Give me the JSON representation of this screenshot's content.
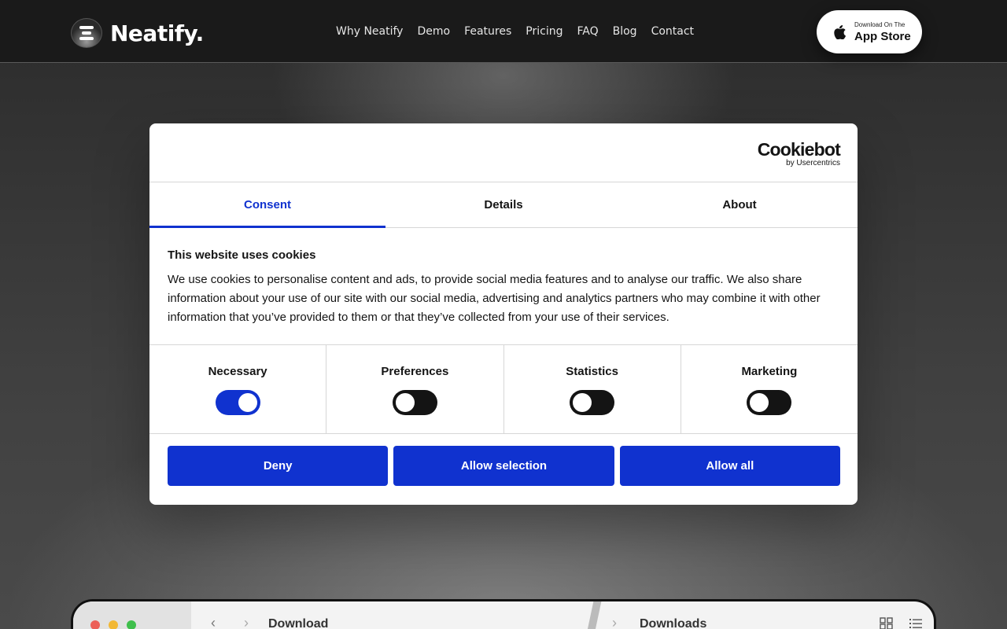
{
  "site": {
    "logo_text": "Neatify.",
    "nav": [
      "Why Neatify",
      "Demo",
      "Features",
      "Pricing",
      "FAQ",
      "Blog",
      "Contact"
    ],
    "app_store": {
      "small": "Download On The",
      "big": "App Store"
    }
  },
  "mock_window": {
    "left_title": "Download",
    "right_title": "Downloads"
  },
  "cookie_dialog": {
    "brand": {
      "name": "Cookiebot",
      "byline": "by Usercentrics"
    },
    "tabs": [
      "Consent",
      "Details",
      "About"
    ],
    "active_tab": "Consent",
    "heading": "This website uses cookies",
    "body": "We use cookies to personalise content and ads, to provide social media features and to analyse our traffic. We also share information about your use of our site with our social media, advertising and analytics partners who may combine it with other information that you’ve provided to them or that they’ve collected from your use of their services.",
    "categories": [
      {
        "label": "Necessary",
        "enabled": true
      },
      {
        "label": "Preferences",
        "enabled": false
      },
      {
        "label": "Statistics",
        "enabled": false
      },
      {
        "label": "Marketing",
        "enabled": false
      }
    ],
    "buttons": {
      "deny": "Deny",
      "allow_selection": "Allow selection",
      "allow_all": "Allow all"
    }
  },
  "colors": {
    "accent": "#1032cf",
    "nav_bg": "#1a1a1a",
    "switch_off": "#141414"
  }
}
